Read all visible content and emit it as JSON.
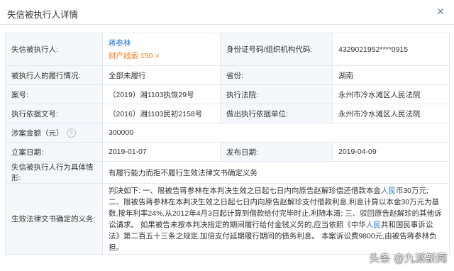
{
  "header": {
    "title": "失信被执行人详情"
  },
  "rows": {
    "executed_person": {
      "label": "失信被执行人:",
      "name": "蒋参林",
      "property_clues": "财产线索 150 >"
    },
    "id_number": {
      "label": "身份证号码/组织机构代码:",
      "value": "4329021952****0915"
    },
    "performance": {
      "label": "被执行人的履行情况:",
      "value": "全部未履行"
    },
    "province": {
      "label": "省份:",
      "value": "湖南"
    },
    "case_no": {
      "label": "案号:",
      "value": "（2019）湘1103执恢29号"
    },
    "court": {
      "label": "执行法院:",
      "value": "永州市冷水滩区人民法院"
    },
    "basis_doc": {
      "label": "执行依据文号:",
      "value": "（2016）湘1103民初2158号"
    },
    "basis_unit": {
      "label": "做出执行依据单位:",
      "value": "永州市冷水滩区人民法院"
    },
    "amount": {
      "label": "涉案金额（元）",
      "value": "300000"
    },
    "filing_date": {
      "label": "立案日期:",
      "value": "2019-01-07"
    },
    "publish_date": {
      "label": "发布日期:",
      "value": "2019-04-09"
    },
    "behavior": {
      "label": "失信被执行人行为具体情形:",
      "value": "有履行能力而拒不履行生效法律文书确定义务"
    },
    "obligation": {
      "label": "生效法律文书确定的义务:",
      "p1": "判决如下: 一、限被告蒋参林在本判决生效之日起七日内向原告赵解珍偿还借款本金",
      "p2": "人民",
      "p3": "币30万元; 二、限被告蒋参林在本判决生效之日起七日内向原告赵解珍支付借款利息,利息计算以本金30万元为基数,按年利率24%,从2012年4月3日起计算到借款给付完毕时止,利随本清; 三、驳回原告赵解珍的其他诉讼请求。 如果被告未按本判决指定的期间履行给付金钱义务的,应当依照《中华",
      "p4": "人民",
      "p5": "共和国民事诉讼法》第二百五十三条之规定,加倍支付延期履行期间的债务利息。 本案诉讼费9800元,由被告蒋参林负担。"
    }
  },
  "watermark": "头条 @九派新闻",
  "icons": {
    "close": "close-icon",
    "help": "help-icon"
  },
  "colors": {
    "link": "#1f6fd1",
    "accent": "#ff7a1a",
    "label_bg": "#f5f8fb",
    "border": "#e4e8ee"
  }
}
